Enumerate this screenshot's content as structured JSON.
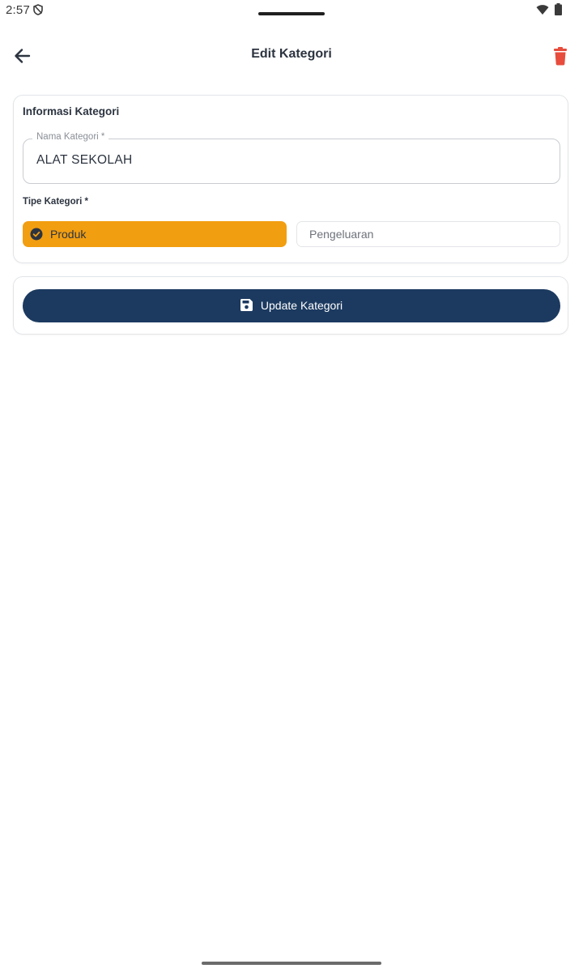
{
  "status_bar": {
    "time": "2:57",
    "icons": [
      "shield-icon",
      "wifi-icon",
      "battery-icon"
    ]
  },
  "app_bar": {
    "title": "Edit Kategori",
    "back_icon": "arrow-left-icon",
    "delete_icon": "trash-icon"
  },
  "form": {
    "section_title": "Informasi Kategori",
    "name_field": {
      "label": "Nama Kategori *",
      "value": "ALAT SEKOLAH"
    },
    "type_label": "Tipe Kategori *",
    "type_options": [
      {
        "label": "Produk",
        "selected": true,
        "icon": "check-circle-icon"
      },
      {
        "label": "Pengeluaran",
        "selected": false
      }
    ]
  },
  "actions": {
    "update_label": "Update Kategori",
    "update_icon": "save-icon"
  },
  "colors": {
    "primary": "#1c3a60",
    "accent": "#f29e11",
    "danger": "#e74c3c",
    "text": "#2c3440"
  }
}
